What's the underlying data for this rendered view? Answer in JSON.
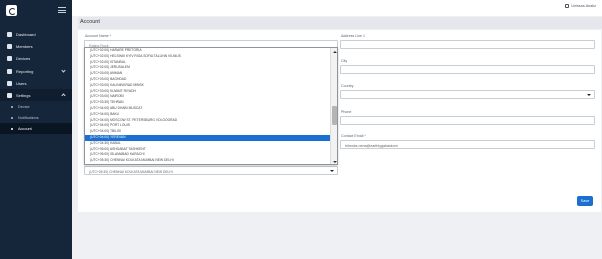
{
  "sidebar": {
    "nav": [
      {
        "label": "Dashboard",
        "icon": "dashboard-icon"
      },
      {
        "label": "Members",
        "icon": "members-icon"
      },
      {
        "label": "Devices",
        "icon": "devices-icon"
      },
      {
        "label": "Reporting",
        "icon": "reporting-icon"
      },
      {
        "label": "Users",
        "icon": "users-icon"
      },
      {
        "label": "Settings",
        "icon": "gear-icon"
      }
    ],
    "sub": [
      {
        "label": "Device"
      },
      {
        "label": "Notifications"
      },
      {
        "label": "Account"
      }
    ]
  },
  "topbar": {
    "user": "Unissus Analiz"
  },
  "page": {
    "title": "Account"
  },
  "form": {
    "account_name_label": "Account Name *",
    "account_name_value": "Rating Rock",
    "timezone_value": "(UTC+05:30) CHENNAI KOLKATA MUMBAI NEW DELHI",
    "address_label": "Address Line 1",
    "city_label": "City",
    "country_label": "Country",
    "phone_label": "Phone",
    "contact_email_label": "Contact Email *",
    "contact_email_value": "bitmobs.nena@earthlygabaskorn",
    "save_label": "Save"
  },
  "timezone_options": [
    "(UTC+02:00) HARARE PRETORIA",
    "(UTC+02:00) HELSINKI KYIV RIGA SOFIA TALLINN VILNIUS",
    "(UTC+02:00) ISTANBUL",
    "(UTC+02:00) JERUSALEM",
    "(UTC+03:00) AMMAN",
    "(UTC+03:00) BAGHDAD",
    "(UTC+03:00) KALININGRAD MINSK",
    "(UTC+03:00) KUWAIT RIYADH",
    "(UTC+03:00) NAIROBI",
    "(UTC+03:30) TEHRAN",
    "(UTC+04:00) ABU DHABI MUSCAT",
    "(UTC+04:00) BAKU",
    "(UTC+04:00) MOSCOW ST. PETERSBURG VOLGOGRAD",
    "(UTC+04:00) PORT LOUIS",
    "(UTC+04:00) TBILISI",
    "(UTC+04:00) YEREVAN",
    "(UTC+04:30) KABUL",
    "(UTC+05:00) ASHGABAT TASHKENT",
    "(UTC+05:00) ISLAMABAD KARACHI",
    "(UTC+05:30) CHENNAI KOLKATA MUMBAI NEW DELHI"
  ],
  "selected_index": 15,
  "colors": {
    "sidebar": "#15253a",
    "accent": "#1a6fd1"
  }
}
